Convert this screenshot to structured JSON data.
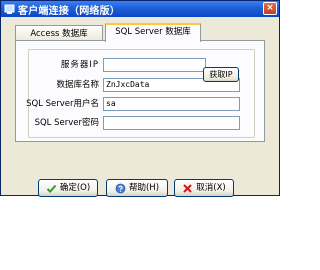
{
  "window": {
    "title": "客户端连接（网络版）",
    "close_label": "×"
  },
  "tabs": [
    {
      "label": "Access 数据库",
      "active": false
    },
    {
      "label": "SQL Server 数据库",
      "active": true
    }
  ],
  "form": {
    "server_ip": {
      "label": "服务器IP",
      "value": ""
    },
    "fetch_ip_label": "获取IP",
    "database_name": {
      "label": "数据库名称",
      "value": "ZnJxcData"
    },
    "username": {
      "label": "SQL Server用户名",
      "value": "sa"
    },
    "password": {
      "label": "SQL Server密码",
      "value": ""
    }
  },
  "buttons": {
    "ok": "确定(O)",
    "help": "帮助(H)",
    "cancel": "取消(X)"
  },
  "colors": {
    "titlebar": "#0a46c7",
    "dialog_bg": "#ece9d8",
    "tab_highlight": "#ffc83c",
    "ok_icon": "#2e9b2e",
    "cancel_icon": "#d01818"
  }
}
